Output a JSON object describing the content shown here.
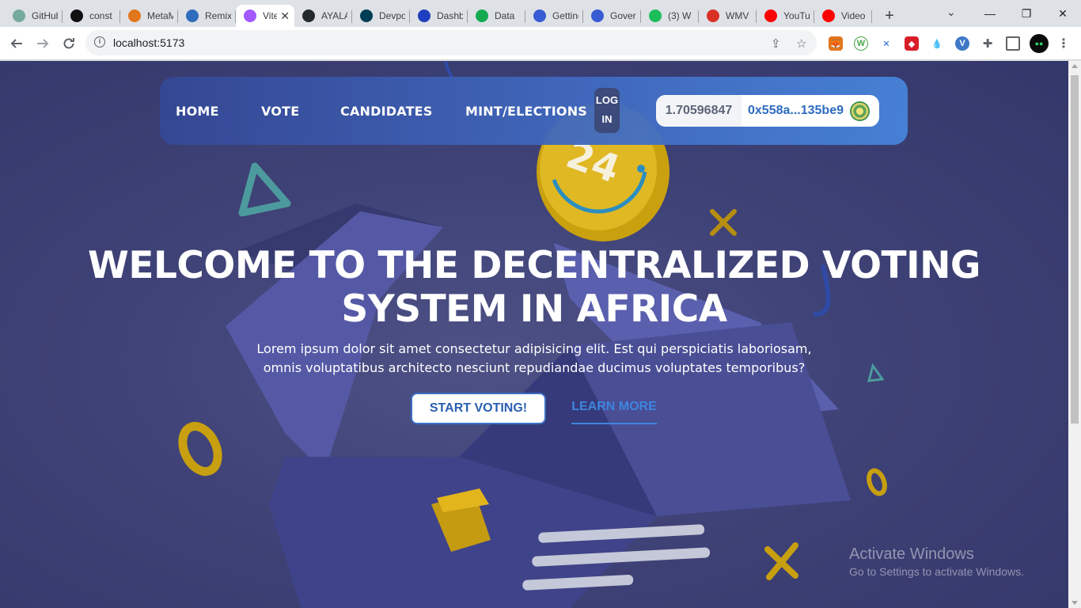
{
  "browser": {
    "tabs": [
      {
        "title": "GitHub",
        "icon": "chatgpt-icon",
        "color": "#74aa9c"
      },
      {
        "title": "const",
        "icon": "p-logo-icon",
        "color": "#111111"
      },
      {
        "title": "MetaMask",
        "icon": "metamask-fox-icon",
        "color": "#e2761b"
      },
      {
        "title": "Remix",
        "icon": "remix-icon",
        "color": "#2f6cbc"
      },
      {
        "title": "Vite",
        "icon": "vite-icon",
        "color": "#a259ff"
      },
      {
        "title": "AYALA",
        "icon": "github-icon",
        "color": "#24292f"
      },
      {
        "title": "Devpost",
        "icon": "devpost-icon",
        "color": "#003e54"
      },
      {
        "title": "Dashboard",
        "icon": "alchemy-icon",
        "color": "#1e3fbf"
      },
      {
        "title": "Data",
        "icon": "mongodb-leaf-icon",
        "color": "#13aa52"
      },
      {
        "title": "Getting",
        "icon": "chainlink-icon",
        "color": "#375bd2"
      },
      {
        "title": "Governance",
        "icon": "chainlink-icon",
        "color": "#375bd2"
      },
      {
        "title": "(3) W",
        "icon": "number-badge-icon",
        "color": "#1cbd5b"
      },
      {
        "title": "WMV",
        "icon": "cloud-icon",
        "color": "#d93025"
      },
      {
        "title": "YouTube",
        "icon": "youtube-icon",
        "color": "#ff0000"
      },
      {
        "title": "Video",
        "icon": "youtube-icon",
        "color": "#ff0000"
      }
    ],
    "active_tab_index": 4,
    "tab_close_glyph": "✕",
    "new_tab_glyph": "+",
    "url": "localhost:5173",
    "window_controls": [
      "—",
      "❐",
      "✕"
    ],
    "chevron": "⌄"
  },
  "navbar": {
    "links": [
      "HOME",
      "VOTE",
      "CANDIDATES",
      "MINT/ELECTIONS"
    ],
    "login_line1": "LOG",
    "login_line2": "IN",
    "wallet_balance": "1.70596847",
    "wallet_address": "0x558a...135be9"
  },
  "hero": {
    "title_line1": "WELCOME TO THE DECENTRALIZED VOTING",
    "title_line2": "SYSTEM IN AFRICA",
    "subtitle_line1": "Lorem ipsum dolor sit amet consectetur adipisicing elit. Est qui perspiciatis laboriosam,",
    "subtitle_line2": "omnis voluptatibus architecto nesciunt repudiandae ducimus voluptates temporibus?",
    "start_button": "START VOTING!",
    "learn_button": "LEARN MORE",
    "coin_number": "24"
  },
  "windows_watermark": {
    "line1": "Activate Windows",
    "line2": "Go to Settings to activate Windows."
  },
  "colors": {
    "accent": "#3a6fc3",
    "link": "#3d86e0",
    "background": "#3f4276"
  }
}
